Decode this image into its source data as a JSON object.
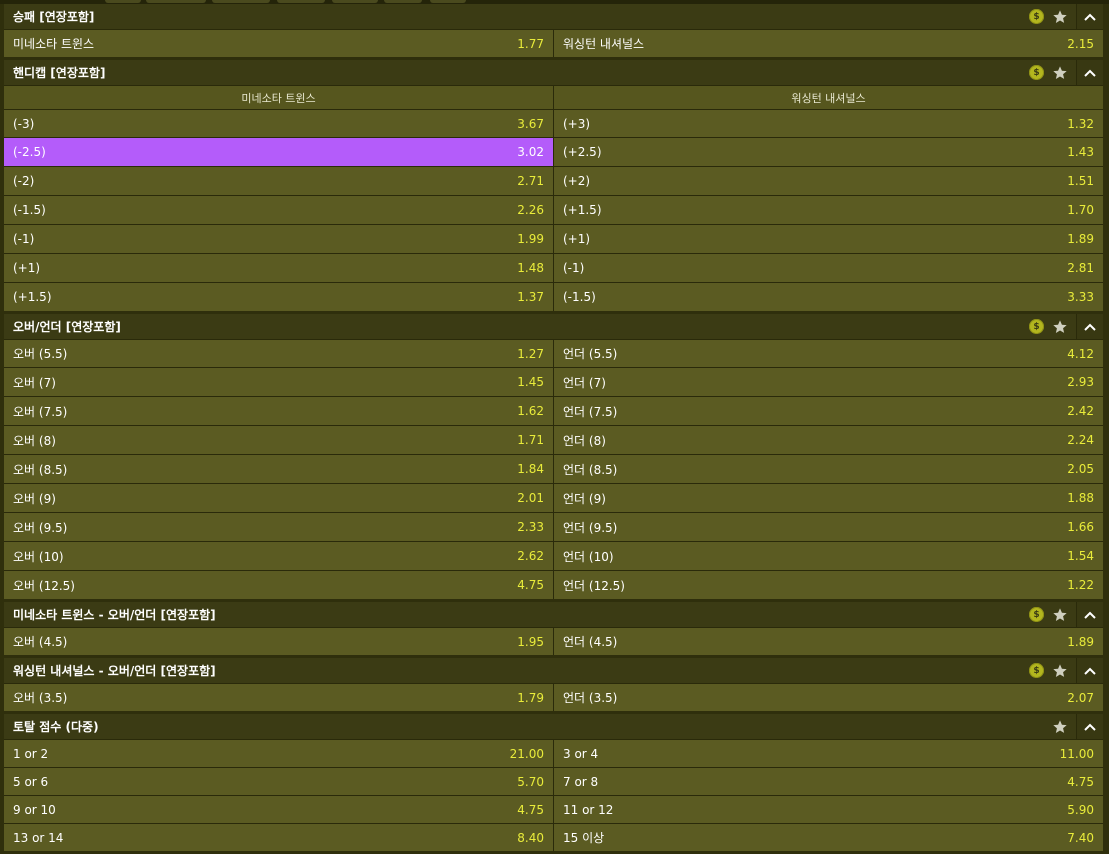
{
  "sections": [
    {
      "title": "승패 [연장포함]",
      "coin": "$",
      "columns": [],
      "rows": [
        {
          "left_label": "미네소타 트윈스",
          "left_odds": "1.77",
          "right_label": "워싱턴 내셔널스",
          "right_odds": "2.15"
        }
      ]
    },
    {
      "title": "핸디캡 [연장포함]",
      "coin": "$",
      "columns": [
        "미네소타 트윈스",
        "워싱턴 내셔널스"
      ],
      "rows": [
        {
          "left_label": "(-3)",
          "left_odds": "3.67",
          "right_label": "(+3)",
          "right_odds": "1.32"
        },
        {
          "left_label": "(-2.5)",
          "left_odds": "3.02",
          "right_label": "(+2.5)",
          "right_odds": "1.43"
        },
        {
          "left_label": "(-2)",
          "left_odds": "2.71",
          "right_label": "(+2)",
          "right_odds": "1.51"
        },
        {
          "left_label": "(-1.5)",
          "left_odds": "2.26",
          "right_label": "(+1.5)",
          "right_odds": "1.70"
        },
        {
          "left_label": "(-1)",
          "left_odds": "1.99",
          "right_label": "(+1)",
          "right_odds": "1.89"
        },
        {
          "left_label": "(+1)",
          "left_odds": "1.48",
          "right_label": "(-1)",
          "right_odds": "2.81"
        },
        {
          "left_label": "(+1.5)",
          "left_odds": "1.37",
          "right_label": "(-1.5)",
          "right_odds": "3.33"
        }
      ]
    },
    {
      "title": "오버/언더 [연장포함]",
      "coin": "$",
      "columns": [],
      "rows": [
        {
          "left_label": "오버 (5.5)",
          "left_odds": "1.27",
          "right_label": "언더 (5.5)",
          "right_odds": "4.12"
        },
        {
          "left_label": "오버 (7)",
          "left_odds": "1.45",
          "right_label": "언더 (7)",
          "right_odds": "2.93"
        },
        {
          "left_label": "오버 (7.5)",
          "left_odds": "1.62",
          "right_label": "언더 (7.5)",
          "right_odds": "2.42"
        },
        {
          "left_label": "오버 (8)",
          "left_odds": "1.71",
          "right_label": "언더 (8)",
          "right_odds": "2.24"
        },
        {
          "left_label": "오버 (8.5)",
          "left_odds": "1.84",
          "right_label": "언더 (8.5)",
          "right_odds": "2.05"
        },
        {
          "left_label": "오버 (9)",
          "left_odds": "2.01",
          "right_label": "언더 (9)",
          "right_odds": "1.88"
        },
        {
          "left_label": "오버 (9.5)",
          "left_odds": "2.33",
          "right_label": "언더 (9.5)",
          "right_odds": "1.66"
        },
        {
          "left_label": "오버 (10)",
          "left_odds": "2.62",
          "right_label": "언더 (10)",
          "right_odds": "1.54"
        },
        {
          "left_label": "오버 (12.5)",
          "left_odds": "4.75",
          "right_label": "언더 (12.5)",
          "right_odds": "1.22"
        }
      ]
    },
    {
      "title": "미네소타 트윈스 - 오버/언더 [연장포함]",
      "coin": "$",
      "columns": [],
      "rows": [
        {
          "left_label": "오버 (4.5)",
          "left_odds": "1.95",
          "right_label": "언더 (4.5)",
          "right_odds": "1.89"
        }
      ]
    },
    {
      "title": "워싱턴 내셔널스 - 오버/언더 [연장포함]",
      "coin": "$",
      "columns": [],
      "rows": [
        {
          "left_label": "오버 (3.5)",
          "left_odds": "1.79",
          "right_label": "언더 (3.5)",
          "right_odds": "2.07"
        }
      ]
    },
    {
      "title": "토탈 점수 (다중)",
      "coin": "",
      "columns": [],
      "rows": [
        {
          "left_label": "1 or 2",
          "left_odds": "21.00",
          "right_label": "3 or 4",
          "right_odds": "11.00"
        },
        {
          "left_label": "5 or 6",
          "left_odds": "5.70",
          "right_label": "7 or 8",
          "right_odds": "4.75"
        },
        {
          "left_label": "9 or 10",
          "left_odds": "4.75",
          "right_label": "11 or 12",
          "right_odds": "5.90"
        },
        {
          "left_label": "13 or 14",
          "left_odds": "8.40",
          "right_label": "15 이상",
          "right_odds": "7.40"
        }
      ]
    }
  ],
  "selected": {
    "section": 1,
    "row": 1,
    "side": "left"
  },
  "colors": {
    "background": "#2f2f0c",
    "cell": "#5b5b22",
    "header": "#3b3b14",
    "odds": "#e9ec3a",
    "selected": "#b45cfa",
    "coin": "#b3b61e"
  },
  "icons": {
    "coin": "coin-icon",
    "star": "star-icon",
    "collapse": "chevron-up-icon"
  }
}
